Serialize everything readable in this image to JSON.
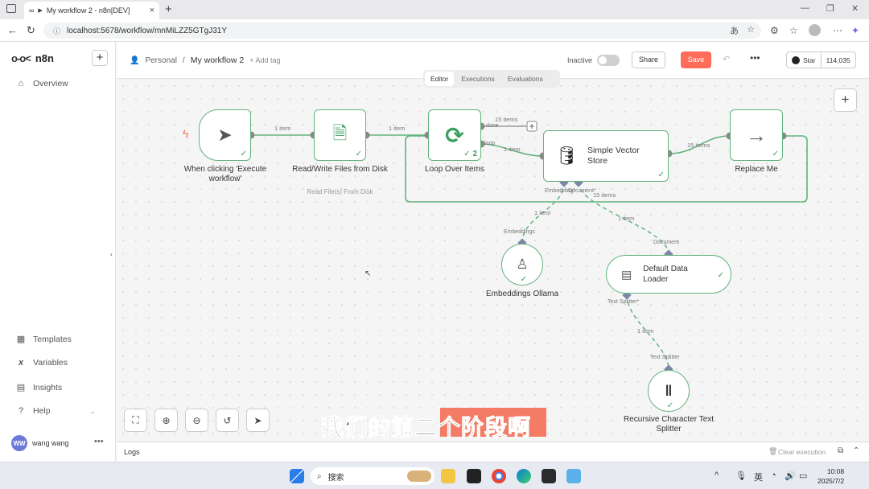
{
  "browser": {
    "tab_title": "My workflow 2 - n8n[DEV]",
    "url": "localhost:5678/workflow/mnMiLZZ5GTgJ31Y"
  },
  "sidebar": {
    "brand": "n8n",
    "overview": "Overview",
    "templates": "Templates",
    "variables": "Variables",
    "insights": "Insights",
    "help": "Help",
    "user_initials": "WW",
    "user_name": "wang wang"
  },
  "header": {
    "personal": "Personal",
    "workflow_name": "My workflow 2",
    "add_tag": "+ Add tag",
    "inactive_label": "Inactive",
    "share": "Share",
    "save": "Save",
    "star": "Star",
    "star_count": "114,035"
  },
  "editor_tabs": [
    "Editor",
    "Executions",
    "Evaluations"
  ],
  "nodes": {
    "trigger": "When clicking 'Execute workflow'",
    "read_write": "Read/Write Files from Disk",
    "read_write_sub": "Read File(s) From Disk",
    "loop": "Loop Over Items",
    "loop_count": "2",
    "vector_store": "Simple Vector Store",
    "replace_me": "Replace Me",
    "embeddings": "Embeddings Ollama",
    "data_loader": "Default Data Loader",
    "text_splitter": "Recursive Character Text Splitter"
  },
  "wire_labels": {
    "w1": "1 item",
    "w2": "1 item",
    "done": "15 items",
    "done_port": "done",
    "loop_port": "loop",
    "loop_item": "1 item",
    "vs_out": "15 items",
    "vs_bottom": "15 items",
    "emb_wire": "1 item",
    "doc_wire": "1 item",
    "ts_wire": "1 item"
  },
  "port_labels": {
    "embedding": "Embedding*",
    "document": "Document*",
    "embeddings": "Embeddings",
    "document_in": "Document",
    "text_splitter_out": "Text Splitter*",
    "text_splitter_in": "Text Splitter"
  },
  "logs": {
    "label": "Logs",
    "clear": "Clear execution"
  },
  "subtitle": "我们的第二个阶段啊",
  "taskbar": {
    "search": "搜索",
    "ime": "英",
    "time": "10:08",
    "date": "2025/7/2"
  },
  "colors": {
    "accent": "#ff6d5a",
    "success": "#3ba05f",
    "wire": "#62b37d"
  }
}
